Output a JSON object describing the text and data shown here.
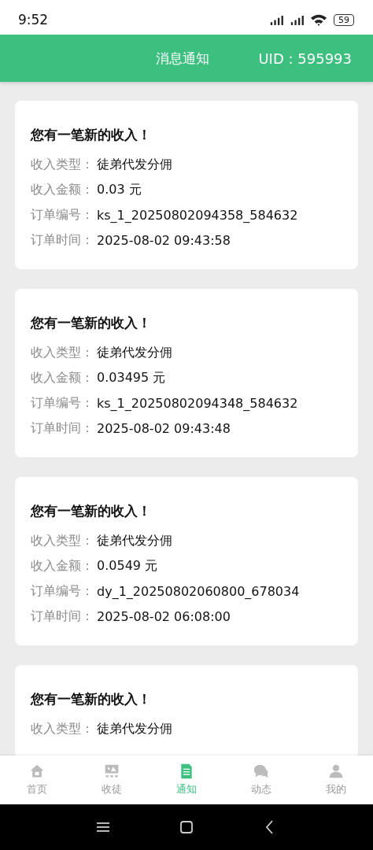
{
  "status_bar": {
    "time": "9:52",
    "battery": "59"
  },
  "header": {
    "title": "消息通知",
    "uid": "UID : 595993"
  },
  "notifications": [
    {
      "title": "您有一笔新的收入！",
      "rows": [
        {
          "label": "收入类型：",
          "value": "徒弟代发分佣"
        },
        {
          "label": "收入金额：",
          "value": "0.03 元"
        },
        {
          "label": "订单编号：",
          "value": "ks_1_20250802094358_584632"
        },
        {
          "label": "订单时间：",
          "value": "2025-08-02 09:43:58"
        }
      ]
    },
    {
      "title": "您有一笔新的收入！",
      "rows": [
        {
          "label": "收入类型：",
          "value": "徒弟代发分佣"
        },
        {
          "label": "收入金额：",
          "value": "0.03495 元"
        },
        {
          "label": "订单编号：",
          "value": "ks_1_20250802094348_584632"
        },
        {
          "label": "订单时间：",
          "value": "2025-08-02 09:43:48"
        }
      ]
    },
    {
      "title": "您有一笔新的收入！",
      "rows": [
        {
          "label": "收入类型：",
          "value": "徒弟代发分佣"
        },
        {
          "label": "收入金额：",
          "value": "0.0549 元"
        },
        {
          "label": "订单编号：",
          "value": "dy_1_20250802060800_678034"
        },
        {
          "label": "订单时间：",
          "value": "2025-08-02 06:08:00"
        }
      ]
    },
    {
      "title": "您有一笔新的收入！",
      "rows": [
        {
          "label": "收入类型：",
          "value": "徒弟代发分佣"
        }
      ]
    }
  ],
  "tab_bar": [
    {
      "kind": "home",
      "label": "首页",
      "selected": false
    },
    {
      "kind": "recruit",
      "label": "收徒",
      "selected": false
    },
    {
      "kind": "notice",
      "label": "通知",
      "selected": true
    },
    {
      "kind": "feed",
      "label": "动态",
      "selected": false
    },
    {
      "kind": "profile",
      "label": "我的",
      "selected": false
    }
  ]
}
